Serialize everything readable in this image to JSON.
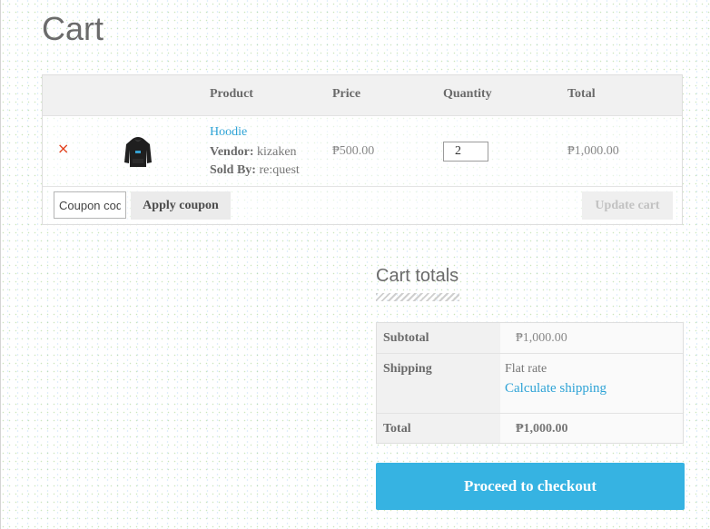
{
  "page": {
    "title": "Cart"
  },
  "cart_table": {
    "headers": {
      "product": "Product",
      "price": "Price",
      "quantity": "Quantity",
      "total": "Total"
    },
    "items": [
      {
        "remove_glyph": "×",
        "thumbnail_icon": "hoodie-icon",
        "name": "Hoodie",
        "vendor_label": "Vendor:",
        "vendor": "kizaken",
        "sold_by_label": "Sold By:",
        "sold_by": "re:quest",
        "price": "₱500.00",
        "quantity": "2",
        "total": "₱1,000.00"
      }
    ],
    "coupon_placeholder": "Coupon code",
    "apply_coupon_label": "Apply coupon",
    "update_cart_label": "Update cart"
  },
  "cart_totals": {
    "title": "Cart totals",
    "subtotal_label": "Subtotal",
    "subtotal": "₱1,000.00",
    "shipping_label": "Shipping",
    "shipping_method": "Flat rate",
    "calculate_shipping_label": "Calculate shipping",
    "total_label": "Total",
    "total": "₱1,000.00"
  },
  "checkout": {
    "label": "Proceed to checkout"
  },
  "colors": {
    "accent": "#36b3e2",
    "link": "#2ea3d6",
    "remove": "#e2401c"
  }
}
